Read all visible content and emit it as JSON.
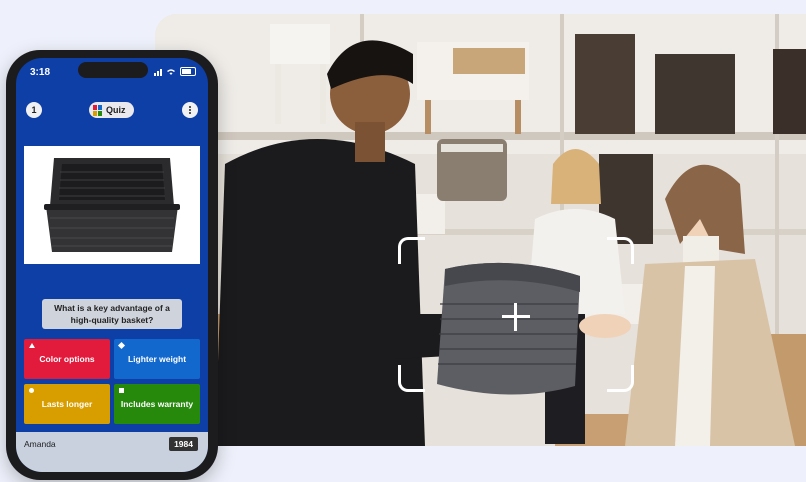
{
  "phone": {
    "status_time": "3:18",
    "header": {
      "question_number": "1",
      "quiz_label": "Quiz"
    },
    "product_image": "black-wicker-basket-icon",
    "question": "What is a key advantage of a high-quality basket?",
    "answers": [
      {
        "label": "Color options",
        "shape": "triangle",
        "color": "#e21b3c"
      },
      {
        "label": "Lighter weight",
        "shape": "diamond",
        "color": "#1368ce"
      },
      {
        "label": "Lasts longer",
        "shape": "circle",
        "color": "#d89e00"
      },
      {
        "label": "Includes warranty",
        "shape": "square",
        "color": "#26890c"
      }
    ],
    "player": {
      "name": "Amanda",
      "score": "1984"
    }
  },
  "scene": {
    "subject": "store-photo-basket-scan",
    "overlay": "scan-frame-with-crosshair"
  },
  "colors": {
    "page_background": "#eef1fb",
    "phone_screen": "#0d3fa6"
  }
}
